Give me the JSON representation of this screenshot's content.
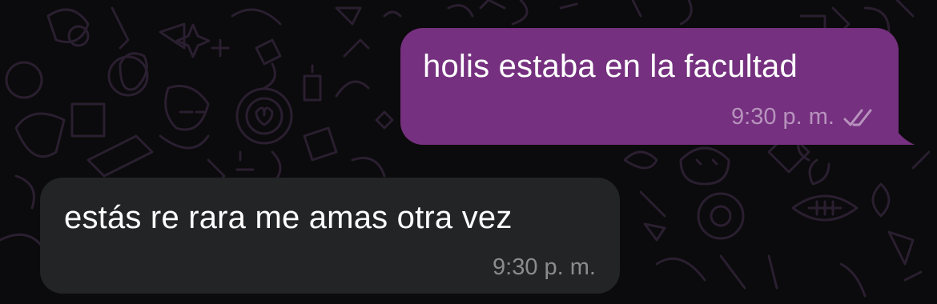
{
  "messages": [
    {
      "direction": "outgoing",
      "text": "holis estaba en la facultad",
      "time": "9:30 p. m.",
      "status": "read-double-check-icon"
    },
    {
      "direction": "incoming",
      "text": "estás re rara me amas otra vez",
      "time": "9:30 p. m."
    }
  ],
  "theme": {
    "background": "#0b0a0c",
    "outgoing_bubble": "#75307f",
    "incoming_bubble": "#232425",
    "pattern_color": "#2a1f30"
  }
}
